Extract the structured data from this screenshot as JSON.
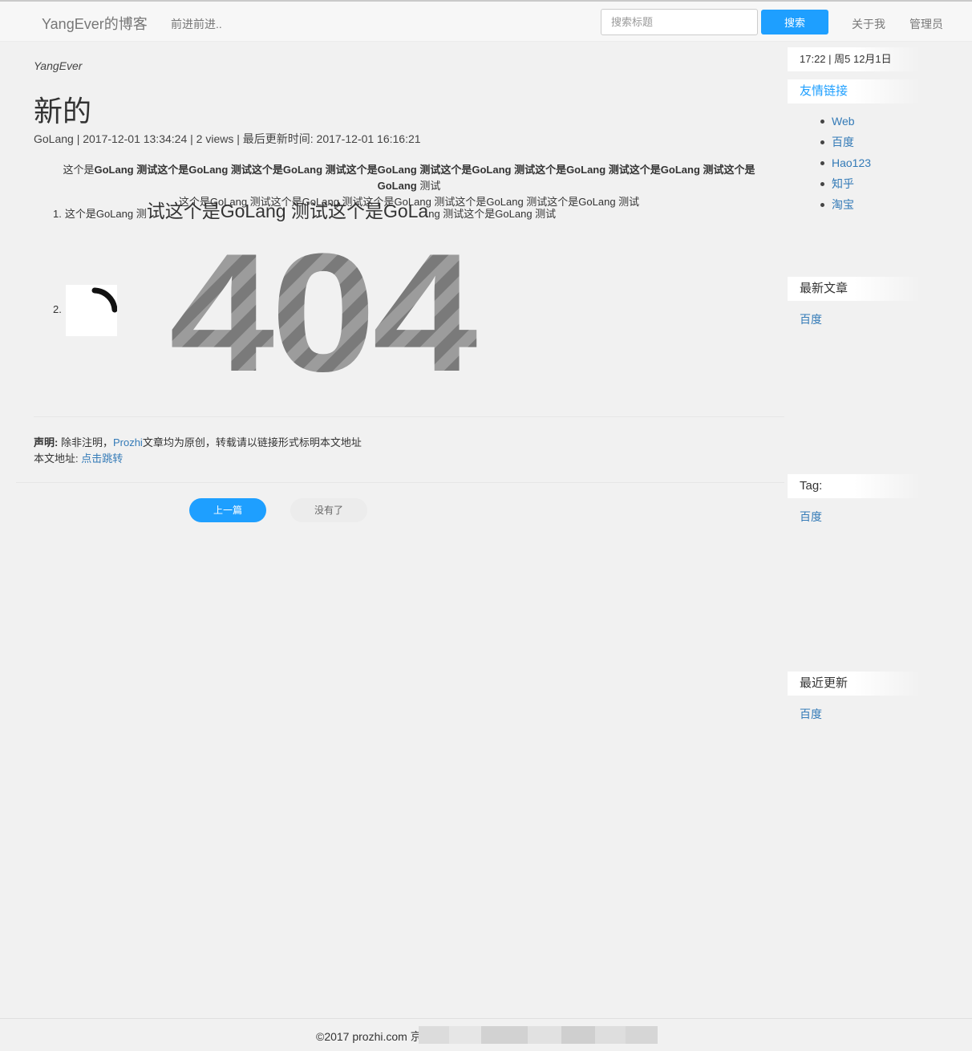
{
  "nav": {
    "brand": "YangEver的博客",
    "slogan": "前进前进..",
    "search_placeholder": "搜索标题",
    "search_button": "搜索",
    "about": "关于我",
    "admin": "管理员"
  },
  "article": {
    "author": "YangEver",
    "title": "新的",
    "meta": "GoLang | 2017-12-01 13:34:24 | 2 views | 最后更新时间: 2017-12-01 16:16:21",
    "para_prefix": "这个是",
    "para_bold": "GoLang 测试这个是GoLang 测试这个是GoLang 测试这个是GoLang 测试这个是GoLang 测试这个是GoLang 测试这个是GoLang 测试这个是GoLang",
    "para_suffix": " 测试",
    "para_line2": "这个是GoLang 测试这个是GoLang 测试这个是GoLang 测试这个是GoLang 测试这个是GoLang 测试",
    "list1_num": "1.",
    "list1_small_a": "这个是GoLang 测",
    "list1_big": "试这个是GoLang 测试这个是GoLa",
    "list1_small_b": "ng 测试这个是GoLang 测试",
    "list2_num": "2.",
    "image_text": "404",
    "statement_label": "声明:",
    "statement_text_a": " 除非注明，",
    "statement_link": "Prozhi",
    "statement_text_b": "文章均为原创，转载请以链接形式标明本文地址",
    "address_label": "本文地址:",
    "address_link": "点击跳转",
    "prev_button": "上一篇",
    "next_button": "没有了"
  },
  "sidebar": {
    "time": "17:22 | 周5 12月1日",
    "friends_title": "友情链接",
    "friends": [
      "Web",
      "百度",
      "Hao123",
      "知乎",
      "淘宝"
    ],
    "latest_title": "最新文章",
    "latest_item": "百度",
    "tag_title": "Tag:",
    "tag_item": "百度",
    "recent_title": "最近更新",
    "recent_item": "百度"
  },
  "footer": {
    "text": "©2017 prozhi.com 京"
  },
  "colors": {
    "accent": "#1e9fff",
    "link": "#337ab7",
    "background": "#f1f1f1"
  }
}
